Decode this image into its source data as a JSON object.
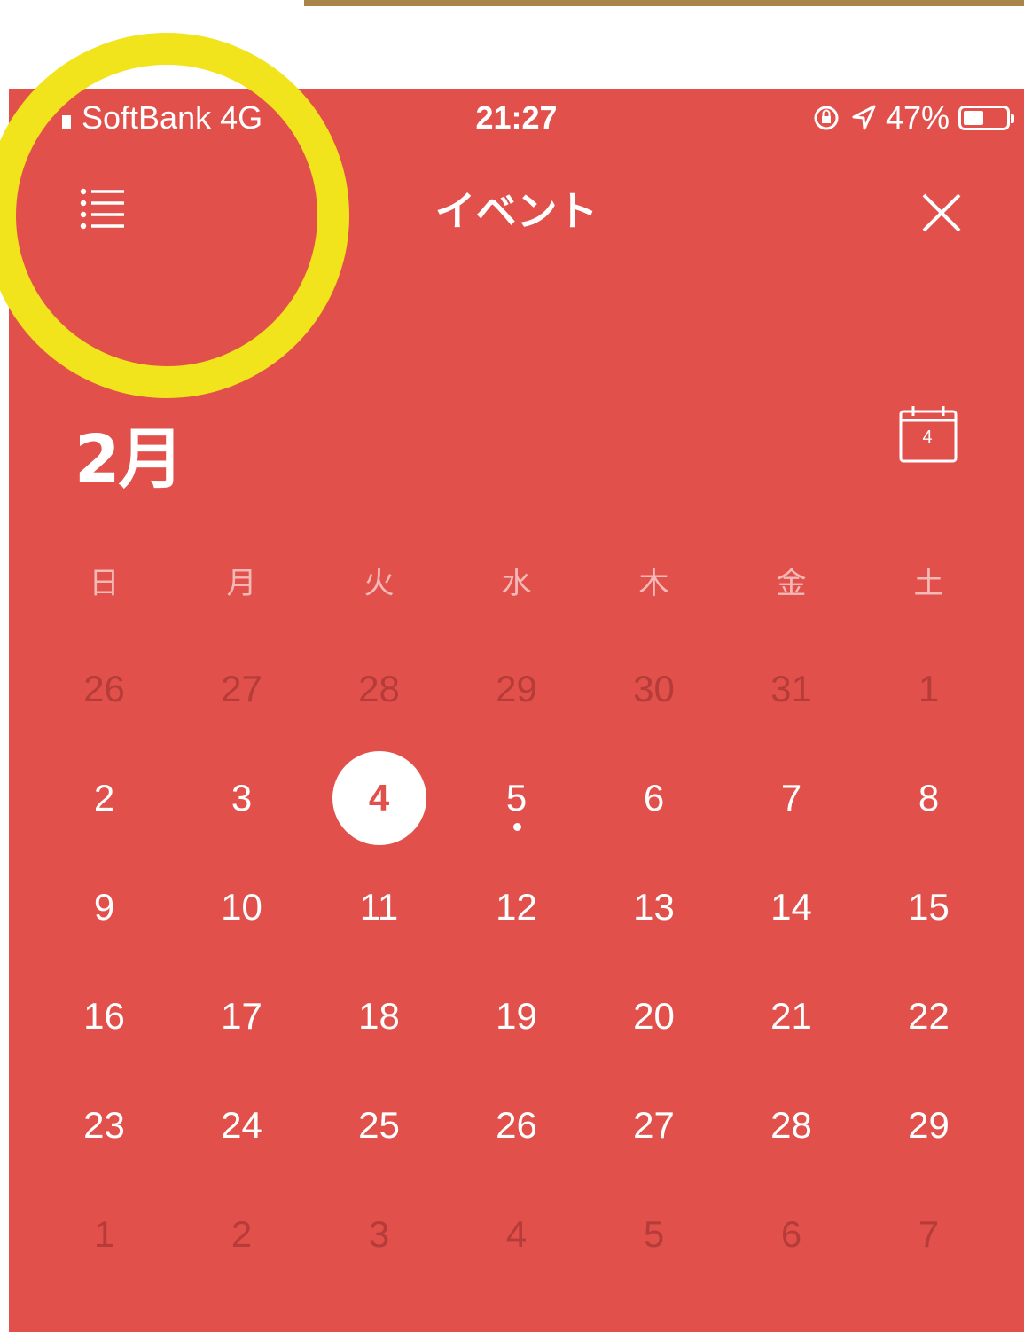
{
  "status_bar": {
    "carrier": "SoftBank  4G",
    "time": "21:27",
    "battery_text": "47%",
    "battery_level": 0.47,
    "icons": [
      "signal-icon",
      "rotation-lock-icon",
      "location-arrow-icon",
      "battery-icon"
    ]
  },
  "nav": {
    "title": "イベント",
    "menu_icon": "list-menu-icon",
    "close_icon": "close-icon"
  },
  "calendar": {
    "month_title": "2月",
    "today_button_day": "4",
    "today_icon": "calendar-today-icon",
    "weekdays": [
      "日",
      "月",
      "火",
      "水",
      "木",
      "金",
      "土"
    ],
    "weeks": [
      [
        {
          "label": "26",
          "muted": true
        },
        {
          "label": "27",
          "muted": true
        },
        {
          "label": "28",
          "muted": true
        },
        {
          "label": "29",
          "muted": true
        },
        {
          "label": "30",
          "muted": true
        },
        {
          "label": "31",
          "muted": true
        },
        {
          "label": "1",
          "muted": true
        }
      ],
      [
        {
          "label": "2"
        },
        {
          "label": "3"
        },
        {
          "label": "4",
          "today": true
        },
        {
          "label": "5",
          "has_event": true
        },
        {
          "label": "6"
        },
        {
          "label": "7"
        },
        {
          "label": "8"
        }
      ],
      [
        {
          "label": "9"
        },
        {
          "label": "10"
        },
        {
          "label": "11"
        },
        {
          "label": "12"
        },
        {
          "label": "13"
        },
        {
          "label": "14"
        },
        {
          "label": "15"
        }
      ],
      [
        {
          "label": "16"
        },
        {
          "label": "17"
        },
        {
          "label": "18"
        },
        {
          "label": "19"
        },
        {
          "label": "20"
        },
        {
          "label": "21"
        },
        {
          "label": "22"
        }
      ],
      [
        {
          "label": "23"
        },
        {
          "label": "24"
        },
        {
          "label": "25"
        },
        {
          "label": "26"
        },
        {
          "label": "27"
        },
        {
          "label": "28"
        },
        {
          "label": "29"
        }
      ],
      [
        {
          "label": "1",
          "muted": true
        },
        {
          "label": "2",
          "muted": true
        },
        {
          "label": "3",
          "muted": true
        },
        {
          "label": "4",
          "muted": true
        },
        {
          "label": "5",
          "muted": true
        },
        {
          "label": "6",
          "muted": true
        },
        {
          "label": "7",
          "muted": true
        }
      ]
    ]
  },
  "colors": {
    "background": "#e2504b",
    "highlight_ring": "#f2e41c",
    "top_strip": "#a9854a"
  }
}
